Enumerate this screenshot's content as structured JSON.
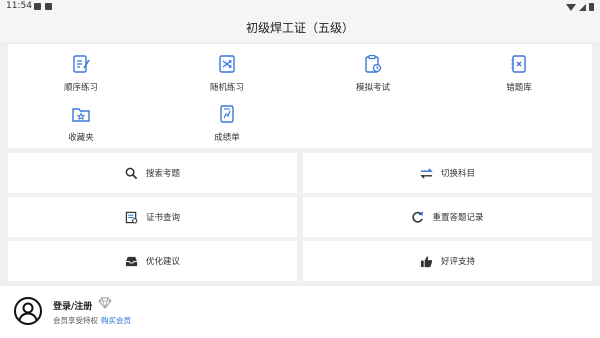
{
  "status": {
    "time": "11:54"
  },
  "header": {
    "title": "初级焊工证（五级）"
  },
  "grid": {
    "items": [
      {
        "label": "顺序练习",
        "icon": "sequential-practice-icon"
      },
      {
        "label": "随机练习",
        "icon": "shuffle-icon"
      },
      {
        "label": "模拟考试",
        "icon": "mock-exam-icon"
      },
      {
        "label": "错题库",
        "icon": "wrong-questions-icon"
      },
      {
        "label": "收藏夹",
        "icon": "favorites-folder-icon"
      },
      {
        "label": "成绩单",
        "icon": "transcript-icon"
      }
    ]
  },
  "actions": {
    "search": "搜索考题",
    "switch_subject": "切换科目",
    "certificate": "证书查询",
    "reset": "重置答题记录",
    "feedback": "优化建议",
    "rate": "好评支持"
  },
  "user": {
    "title": "登录/注册",
    "subtitle": "会员享受特权",
    "buy": "购买会员"
  },
  "colors": {
    "accent": "#2b6fd6",
    "icon_blue": "#3a78d8",
    "icon_dark": "#333333"
  }
}
